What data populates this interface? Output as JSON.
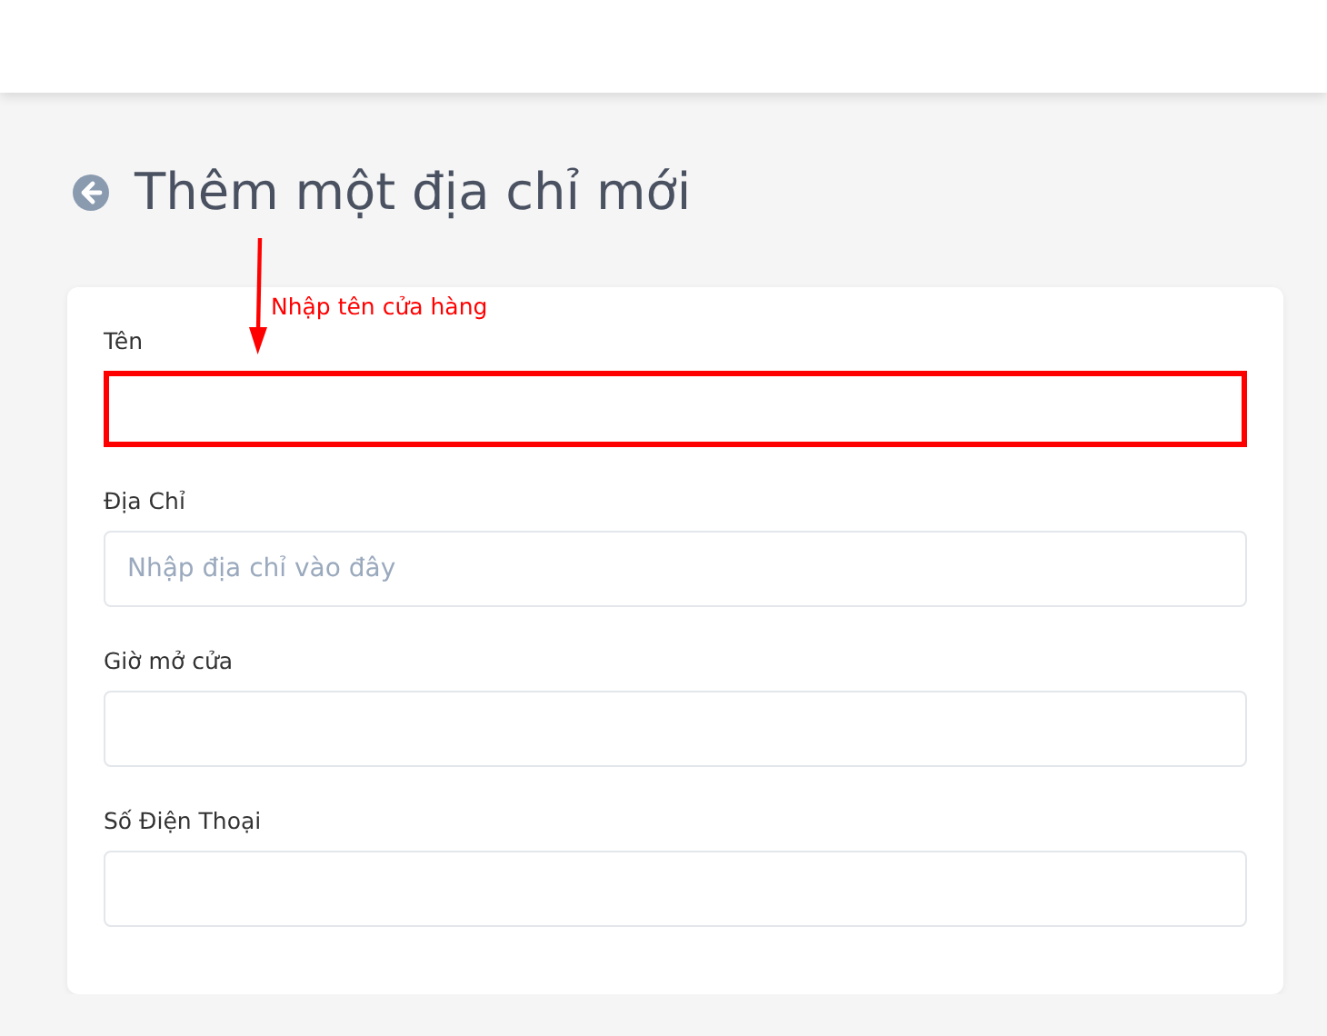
{
  "title": "Thêm một địa chỉ mới",
  "annotation": {
    "text": "Nhập tên cửa hàng"
  },
  "fields": [
    {
      "label": "Tên",
      "highlighted": true
    },
    {
      "label": "Địa Chỉ",
      "placeholder": "Nhập địa chỉ vào đây",
      "highlighted": false
    },
    {
      "label": "Giờ mở cửa",
      "highlighted": false
    },
    {
      "label": "Số Điện Thoại",
      "highlighted": false
    }
  ]
}
